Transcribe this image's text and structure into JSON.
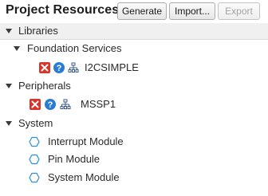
{
  "header": {
    "title": "Project Resources",
    "buttons": {
      "generate": "Generate",
      "import": "Import...",
      "export": "Export"
    }
  },
  "tree": {
    "libraries": "Libraries",
    "foundation_services": "Foundation Services",
    "i2csimple": "I2CSIMPLE",
    "peripherals": "Peripherals",
    "mssp1": "MSSP1",
    "system": "System",
    "interrupt_module": "Interrupt Module",
    "pin_module": "Pin Module",
    "system_module": "System Module"
  },
  "icons": {
    "remove": "remove-icon",
    "help": "help-icon",
    "tree": "hierarchy-icon",
    "module": "hexagon-icon"
  }
}
